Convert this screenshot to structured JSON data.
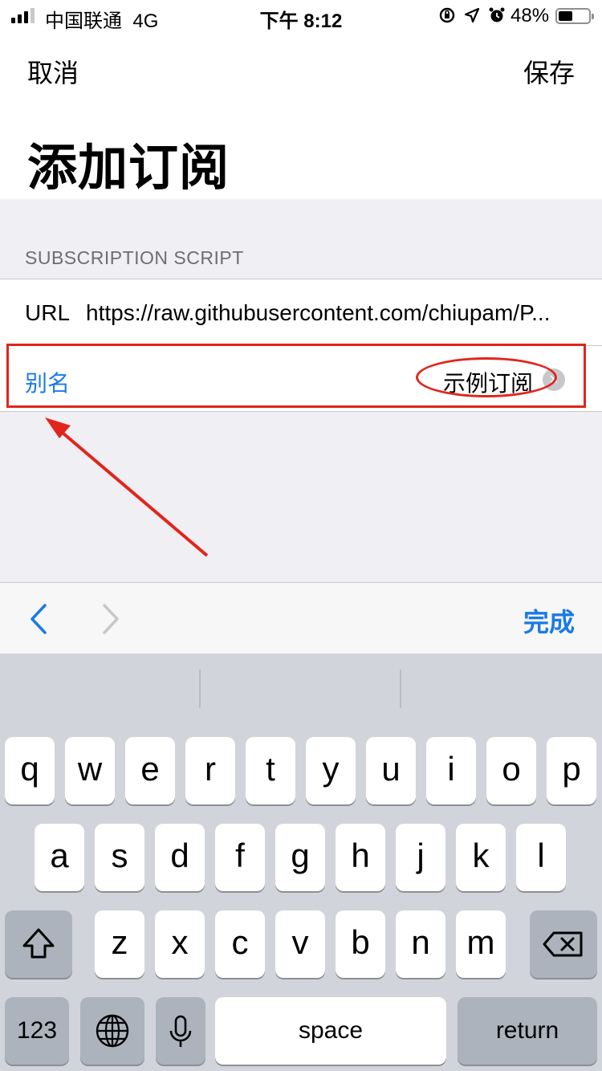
{
  "status_bar": {
    "carrier": "中国联通",
    "network": "4G",
    "time": "下午 8:12",
    "battery_percent": "48%",
    "battery_level": 0.48
  },
  "nav": {
    "cancel_label": "取消",
    "save_label": "保存",
    "title": "添加订阅"
  },
  "section": {
    "header": "SUBSCRIPTION SCRIPT",
    "url_label": "URL",
    "url_value": "https://raw.githubusercontent.com/chiupam/P...",
    "alias_label": "别名",
    "alias_value": "示例订阅"
  },
  "accessory": {
    "done_label": "完成"
  },
  "keyboard": {
    "row1": [
      "q",
      "w",
      "e",
      "r",
      "t",
      "y",
      "u",
      "i",
      "o",
      "p"
    ],
    "row2": [
      "a",
      "s",
      "d",
      "f",
      "g",
      "h",
      "j",
      "k",
      "l"
    ],
    "row3": [
      "z",
      "x",
      "c",
      "v",
      "b",
      "n",
      "m"
    ],
    "numbers_label": "123",
    "space_label": "space",
    "return_label": "return"
  },
  "annotation_color": "#e1251b",
  "accent_color": "#1a7ae6"
}
